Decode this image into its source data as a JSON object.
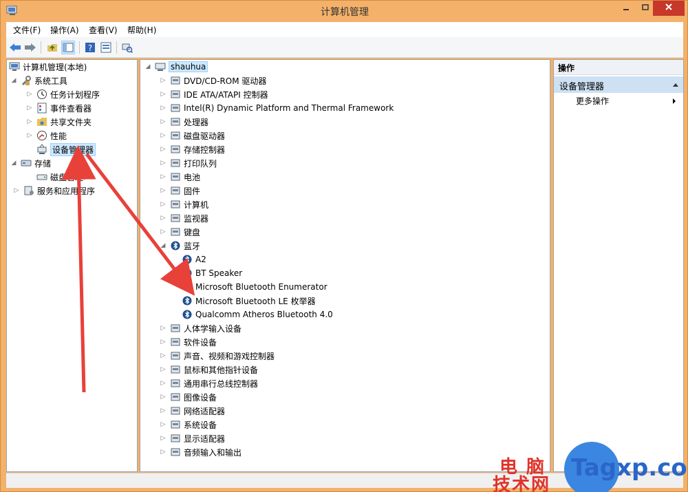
{
  "window": {
    "title": "计算机管理"
  },
  "menu": [
    {
      "label": "文件(F)"
    },
    {
      "label": "操作(A)"
    },
    {
      "label": "查看(V)"
    },
    {
      "label": "帮助(H)"
    }
  ],
  "toolbar": [
    "back-icon",
    "forward-icon",
    "up-folder-icon",
    "show-hide-tree-icon",
    "help-icon",
    "properties-icon",
    "scan-hardware-icon"
  ],
  "left_tree": [
    {
      "label": "计算机管理(本地)",
      "icon": "computer-management-icon"
    },
    {
      "label": "系统工具",
      "icon": "system-tools-icon"
    },
    {
      "label": "任务计划程序",
      "icon": "task-scheduler-icon"
    },
    {
      "label": "事件查看器",
      "icon": "event-viewer-icon"
    },
    {
      "label": "共享文件夹",
      "icon": "shared-folders-icon"
    },
    {
      "label": "性能",
      "icon": "performance-icon"
    },
    {
      "label": "设备管理器",
      "icon": "device-manager-icon"
    },
    {
      "label": "存储",
      "icon": "storage-icon"
    },
    {
      "label": "磁盘管理",
      "icon": "disk-management-icon"
    },
    {
      "label": "服务和应用程序",
      "icon": "services-apps-icon"
    }
  ],
  "device_tree": {
    "root": "shauhua",
    "categories": [
      {
        "label": "DVD/CD-ROM 驱动器",
        "icon": "dvd-drive-icon"
      },
      {
        "label": "IDE ATA/ATAPI 控制器",
        "icon": "ide-controller-icon"
      },
      {
        "label": "Intel(R) Dynamic Platform and Thermal Framework",
        "icon": "thermal-framework-icon"
      },
      {
        "label": "处理器",
        "icon": "processor-icon"
      },
      {
        "label": "磁盘驱动器",
        "icon": "disk-drive-icon"
      },
      {
        "label": "存储控制器",
        "icon": "storage-controller-icon"
      },
      {
        "label": "打印队列",
        "icon": "printer-icon"
      },
      {
        "label": "电池",
        "icon": "battery-icon"
      },
      {
        "label": "固件",
        "icon": "firmware-icon"
      },
      {
        "label": "计算机",
        "icon": "computer-icon"
      },
      {
        "label": "监视器",
        "icon": "monitor-icon"
      },
      {
        "label": "键盘",
        "icon": "keyboard-icon"
      },
      {
        "label": "蓝牙",
        "icon": "bluetooth-icon"
      }
    ],
    "bluetooth_children": [
      {
        "label": "A2"
      },
      {
        "label": "BT Speaker"
      },
      {
        "label": "Microsoft Bluetooth Enumerator"
      },
      {
        "label": "Microsoft Bluetooth LE 枚举器"
      },
      {
        "label": "Qualcomm Atheros Bluetooth 4.0"
      }
    ],
    "more_categories": [
      {
        "label": "人体学输入设备",
        "icon": "hid-icon"
      },
      {
        "label": "软件设备",
        "icon": "software-device-icon"
      },
      {
        "label": "声音、视频和游戏控制器",
        "icon": "sound-icon"
      },
      {
        "label": "鼠标和其他指针设备",
        "icon": "mouse-icon"
      },
      {
        "label": "通用串行总线控制器",
        "icon": "usb-icon"
      },
      {
        "label": "图像设备",
        "icon": "camera-icon"
      },
      {
        "label": "网络适配器",
        "icon": "network-adapter-icon"
      },
      {
        "label": "系统设备",
        "icon": "system-device-icon"
      },
      {
        "label": "显示适配器",
        "icon": "display-adapter-icon"
      },
      {
        "label": "音频输入和输出",
        "icon": "audio-io-icon"
      }
    ]
  },
  "actions": {
    "header": "操作",
    "section": "设备管理器",
    "item": "更多操作"
  },
  "watermark": {
    "cn_line1": "电 脑",
    "cn_line2": "技术网",
    "en": "Tagxp.com"
  },
  "colors": {
    "title_bar": "#f3b16a",
    "selection": "#cce8ff",
    "actions_section": "#cde1f3",
    "arrow": "#e8413a"
  }
}
